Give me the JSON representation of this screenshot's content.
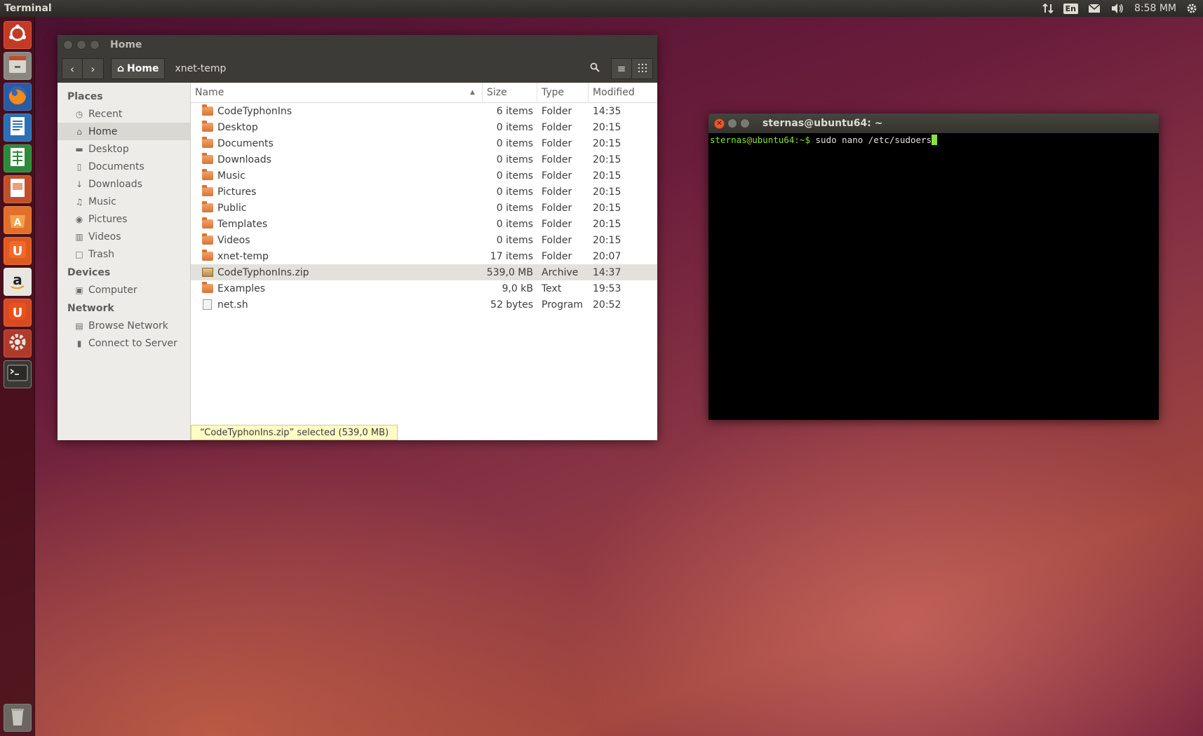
{
  "top_panel": {
    "app_title": "Terminal",
    "keyboard_layout": "En",
    "clock": "8:58 MM"
  },
  "launcher": {
    "items": [
      {
        "name": "ubuntu-dash",
        "icon": "ubuntu-logo-icon"
      },
      {
        "name": "files",
        "icon": "file-cabinet-icon"
      },
      {
        "name": "firefox",
        "icon": "firefox-icon"
      },
      {
        "name": "libreoffice-writer",
        "icon": "writer-icon"
      },
      {
        "name": "libreoffice-calc",
        "icon": "calc-icon"
      },
      {
        "name": "libreoffice-impress",
        "icon": "impress-icon"
      },
      {
        "name": "software-center",
        "icon": "software-center-icon"
      },
      {
        "name": "ubuntu-one",
        "icon": "ubuntu-one-icon"
      },
      {
        "name": "amazon",
        "icon": "amazon-icon"
      },
      {
        "name": "ubuntu-one-music",
        "icon": "ubuntu-one-icon"
      },
      {
        "name": "system-settings",
        "icon": "settings-icon"
      },
      {
        "name": "terminal",
        "icon": "terminal-icon"
      },
      {
        "name": "trash",
        "icon": "trash-icon"
      }
    ]
  },
  "nautilus": {
    "title": "Home",
    "breadcrumb": {
      "home": "Home",
      "next": "xnet-temp"
    },
    "sidebar": {
      "places_heading": "Places",
      "places": [
        {
          "label": "Recent",
          "icon": "clock-icon"
        },
        {
          "label": "Home",
          "icon": "home-icon",
          "active": true
        },
        {
          "label": "Desktop",
          "icon": "folder-icon"
        },
        {
          "label": "Documents",
          "icon": "document-icon"
        },
        {
          "label": "Downloads",
          "icon": "download-icon"
        },
        {
          "label": "Music",
          "icon": "music-icon"
        },
        {
          "label": "Pictures",
          "icon": "camera-icon"
        },
        {
          "label": "Videos",
          "icon": "film-icon"
        },
        {
          "label": "Trash",
          "icon": "trash-icon"
        }
      ],
      "devices_heading": "Devices",
      "devices": [
        {
          "label": "Computer",
          "icon": "computer-icon"
        }
      ],
      "network_heading": "Network",
      "network": [
        {
          "label": "Browse Network",
          "icon": "network-icon"
        },
        {
          "label": "Connect to Server",
          "icon": "server-icon"
        }
      ]
    },
    "columns": {
      "name": "Name",
      "size": "Size",
      "type": "Type",
      "modified": "Modified"
    },
    "files": [
      {
        "name": "CodeTyphonIns",
        "size": "6 items",
        "type": "Folder",
        "modified": "14:35",
        "kind": "folder"
      },
      {
        "name": "Desktop",
        "size": "0 items",
        "type": "Folder",
        "modified": "20:15",
        "kind": "folder"
      },
      {
        "name": "Documents",
        "size": "0 items",
        "type": "Folder",
        "modified": "20:15",
        "kind": "folder"
      },
      {
        "name": "Downloads",
        "size": "0 items",
        "type": "Folder",
        "modified": "20:15",
        "kind": "folder"
      },
      {
        "name": "Music",
        "size": "0 items",
        "type": "Folder",
        "modified": "20:15",
        "kind": "folder"
      },
      {
        "name": "Pictures",
        "size": "0 items",
        "type": "Folder",
        "modified": "20:15",
        "kind": "folder"
      },
      {
        "name": "Public",
        "size": "0 items",
        "type": "Folder",
        "modified": "20:15",
        "kind": "folder"
      },
      {
        "name": "Templates",
        "size": "0 items",
        "type": "Folder",
        "modified": "20:15",
        "kind": "folder"
      },
      {
        "name": "Videos",
        "size": "0 items",
        "type": "Folder",
        "modified": "20:15",
        "kind": "folder"
      },
      {
        "name": "xnet-temp",
        "size": "17 items",
        "type": "Folder",
        "modified": "20:07",
        "kind": "folder"
      },
      {
        "name": "CodeTyphonIns.zip",
        "size": "539,0 MB",
        "type": "Archive",
        "modified": "14:37",
        "kind": "archive",
        "selected": true
      },
      {
        "name": "Examples",
        "size": "9,0 kB",
        "type": "Text",
        "modified": "19:53",
        "kind": "folder"
      },
      {
        "name": "net.sh",
        "size": "52 bytes",
        "type": "Program",
        "modified": "20:52",
        "kind": "file"
      }
    ],
    "status": "“CodeTyphonIns.zip” selected  (539,0 MB)"
  },
  "terminal": {
    "title": "sternas@ubuntu64: ~",
    "prompt": "sternas@ubuntu64:~$",
    "command": " sudo nano /etc/sudoers"
  }
}
